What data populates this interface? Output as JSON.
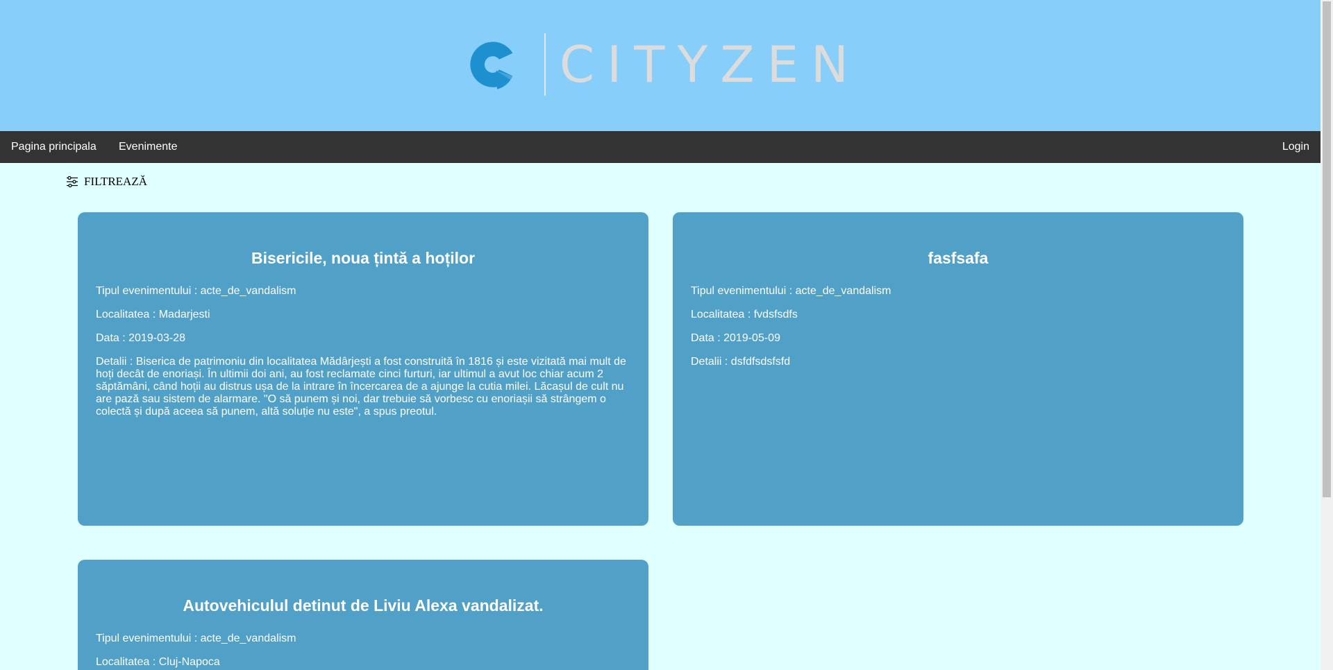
{
  "brand": {
    "name": "CITYZEN",
    "color": "#1e90d0"
  },
  "nav": {
    "home": "Pagina principala",
    "events": "Evenimente",
    "login": "Login"
  },
  "filter": {
    "label": "FILTREAZĂ",
    "icon": "sliders-icon"
  },
  "cards": [
    {
      "title": "Bisericile, noua țintă a hoților",
      "type": "Tipul evenimentului : acte_de_vandalism",
      "location": "Localitatea : Madarjesti",
      "date": "Data : 2019-03-28",
      "details": "Detalii : Biserica de patrimoniu din localitatea Mădârjești a fost construită în 1816 și este vizitată mai mult de hoți decât de enoriași. În ultimii doi ani, au fost reclamate cinci furturi, iar ultimul a avut loc chiar acum 2 săptămâni, când hoții au distrus ușa de la intrare în încercarea de a ajunge la cutia milei. Lăcașul de cult nu are pază sau sistem de alarmare. \"O să punem și noi, dar trebuie să vorbesc cu enoriașii să strângem o colectă și după aceea să punem, altă soluție nu este\", a spus preotul."
    },
    {
      "title": "fasfsafa",
      "type": "Tipul evenimentului : acte_de_vandalism",
      "location": "Localitatea : fvdsfsdfs",
      "date": "Data : 2019-05-09",
      "details": "Detalii : dsfdfsdsfsfd"
    },
    {
      "title": "Autovehiculul detinut de Liviu Alexa vandalizat.",
      "type": "Tipul evenimentului : acte_de_vandalism",
      "location": "Localitatea : Cluj-Napoca"
    }
  ]
}
